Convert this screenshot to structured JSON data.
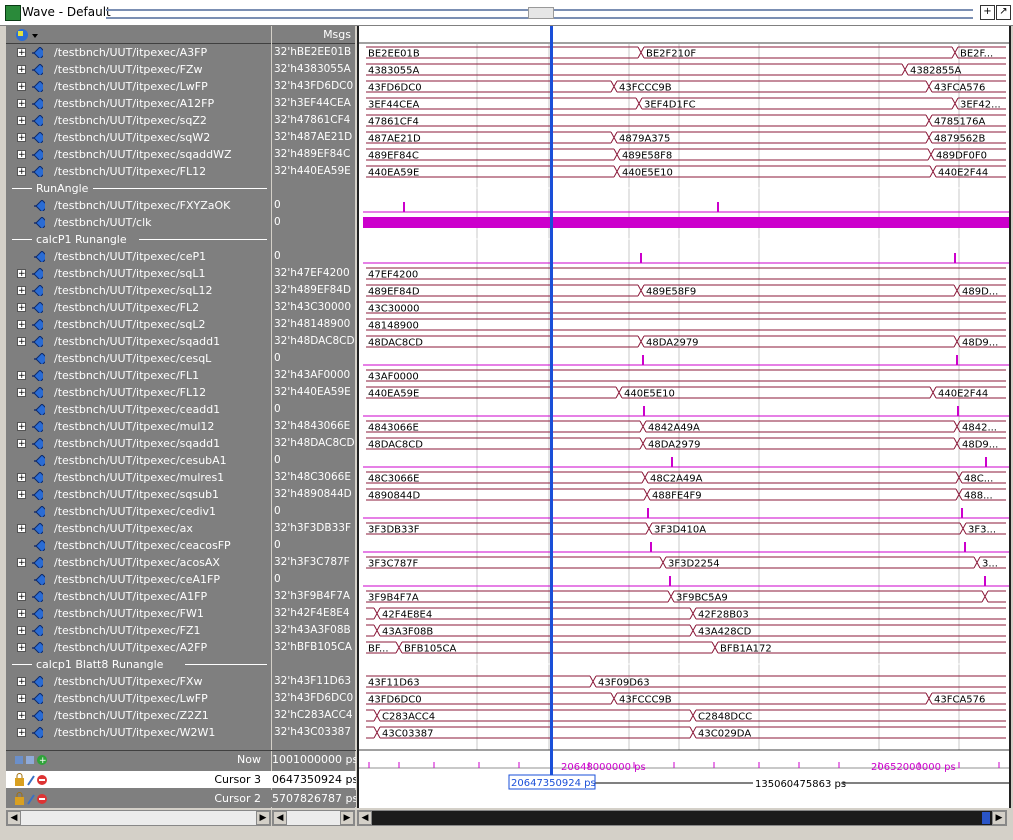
{
  "window": {
    "title": "Wave - Default"
  },
  "header": {
    "msgs_label": "Msgs"
  },
  "rows": [
    {
      "kind": "sig",
      "expand": true,
      "name": "/testbnch/UUT/itpexec/A3FP",
      "value": "32'hBE2EE01B"
    },
    {
      "kind": "sig",
      "expand": true,
      "name": "/testbnch/UUT/itpexec/FZw",
      "value": "32'h4383055A"
    },
    {
      "kind": "sig",
      "expand": true,
      "name": "/testbnch/UUT/itpexec/LwFP",
      "value": "32'h43FD6DC0"
    },
    {
      "kind": "sig",
      "expand": true,
      "name": "/testbnch/UUT/itpexec/A12FP",
      "value": "32'h3EF44CEA"
    },
    {
      "kind": "sig",
      "expand": true,
      "name": "/testbnch/UUT/itpexec/sqZ2",
      "value": "32'h47861CF4"
    },
    {
      "kind": "sig",
      "expand": true,
      "name": "/testbnch/UUT/itpexec/sqW2",
      "value": "32'h487AE21D"
    },
    {
      "kind": "sig",
      "expand": true,
      "name": "/testbnch/UUT/itpexec/sqaddWZ",
      "value": "32'h489EF84C"
    },
    {
      "kind": "sig",
      "expand": true,
      "name": "/testbnch/UUT/itpexec/FL12",
      "value": "32'h440EA59E"
    },
    {
      "kind": "sep",
      "name": "RunAngle",
      "value": ""
    },
    {
      "kind": "sig",
      "expand": false,
      "name": "/testbnch/UUT/itpexec/FXYZaOK",
      "value": "0"
    },
    {
      "kind": "sig",
      "expand": false,
      "name": "/testbnch/UUT/clk",
      "value": "0"
    },
    {
      "kind": "sep",
      "name": "calcP1 Runangle",
      "value": ""
    },
    {
      "kind": "sig",
      "expand": false,
      "name": "/testbnch/UUT/itpexec/ceP1",
      "value": "0"
    },
    {
      "kind": "sig",
      "expand": true,
      "name": "/testbnch/UUT/itpexec/sqL1",
      "value": "32'h47EF4200"
    },
    {
      "kind": "sig",
      "expand": true,
      "name": "/testbnch/UUT/itpexec/sqL12",
      "value": "32'h489EF84D"
    },
    {
      "kind": "sig",
      "expand": true,
      "name": "/testbnch/UUT/itpexec/FL2",
      "value": "32'h43C30000"
    },
    {
      "kind": "sig",
      "expand": true,
      "name": "/testbnch/UUT/itpexec/sqL2",
      "value": "32'h48148900"
    },
    {
      "kind": "sig",
      "expand": true,
      "name": "/testbnch/UUT/itpexec/sqadd1",
      "value": "32'h48DAC8CD"
    },
    {
      "kind": "sig",
      "expand": false,
      "name": "/testbnch/UUT/itpexec/cesqL",
      "value": "0"
    },
    {
      "kind": "sig",
      "expand": true,
      "name": "/testbnch/UUT/itpexec/FL1",
      "value": "32'h43AF0000"
    },
    {
      "kind": "sig",
      "expand": true,
      "name": "/testbnch/UUT/itpexec/FL12",
      "value": "32'h440EA59E"
    },
    {
      "kind": "sig",
      "expand": false,
      "name": "/testbnch/UUT/itpexec/ceadd1",
      "value": "0"
    },
    {
      "kind": "sig",
      "expand": true,
      "name": "/testbnch/UUT/itpexec/mul12",
      "value": "32'h4843066E"
    },
    {
      "kind": "sig",
      "expand": true,
      "name": "/testbnch/UUT/itpexec/sqadd1",
      "value": "32'h48DAC8CD"
    },
    {
      "kind": "sig",
      "expand": false,
      "name": "/testbnch/UUT/itpexec/cesubA1",
      "value": "0"
    },
    {
      "kind": "sig",
      "expand": true,
      "name": "/testbnch/UUT/itpexec/mulres1",
      "value": "32'h48C3066E"
    },
    {
      "kind": "sig",
      "expand": true,
      "name": "/testbnch/UUT/itpexec/sqsub1",
      "value": "32'h4890844D"
    },
    {
      "kind": "sig",
      "expand": false,
      "name": "/testbnch/UUT/itpexec/cediv1",
      "value": "0"
    },
    {
      "kind": "sig",
      "expand": true,
      "name": "/testbnch/UUT/itpexec/ax",
      "value": "32'h3F3DB33F"
    },
    {
      "kind": "sig",
      "expand": false,
      "name": "/testbnch/UUT/itpexec/ceacosFP",
      "value": "0"
    },
    {
      "kind": "sig",
      "expand": true,
      "name": "/testbnch/UUT/itpexec/acosAX",
      "value": "32'h3F3C787F"
    },
    {
      "kind": "sig",
      "expand": false,
      "name": "/testbnch/UUT/itpexec/ceA1FP",
      "value": "0"
    },
    {
      "kind": "sig",
      "expand": true,
      "name": "/testbnch/UUT/itpexec/A1FP",
      "value": "32'h3F9B4F7A"
    },
    {
      "kind": "sig",
      "expand": true,
      "name": "/testbnch/UUT/itpexec/FW1",
      "value": "32'h42F4E8E4"
    },
    {
      "kind": "sig",
      "expand": true,
      "name": "/testbnch/UUT/itpexec/FZ1",
      "value": "32'h43A3F08B"
    },
    {
      "kind": "sig",
      "expand": true,
      "name": "/testbnch/UUT/itpexec/A2FP",
      "value": "32'hBFB105CA"
    },
    {
      "kind": "sep",
      "name": "calcp1 Blatt8 Runangle",
      "value": ""
    },
    {
      "kind": "sig",
      "expand": true,
      "name": "/testbnch/UUT/itpexec/FXw",
      "value": "32'h43F11D63"
    },
    {
      "kind": "sig",
      "expand": true,
      "name": "/testbnch/UUT/itpexec/LwFP",
      "value": "32'h43FD6DC0"
    },
    {
      "kind": "sig",
      "expand": true,
      "name": "/testbnch/UUT/itpexec/Z2Z1",
      "value": "32'hC283ACC4"
    },
    {
      "kind": "sig",
      "expand": true,
      "name": "/testbnch/UUT/itpexec/W2W1",
      "value": "32'h43C03387"
    }
  ],
  "waves": [
    {
      "t": "bus",
      "segs": [
        [
          4,
          "BE2EE01B"
        ],
        [
          282,
          "BE2F210F"
        ],
        [
          596,
          "BE2F..."
        ]
      ]
    },
    {
      "t": "bus",
      "segs": [
        [
          4,
          "4383055A"
        ],
        [
          546,
          "4382855A"
        ]
      ]
    },
    {
      "t": "bus",
      "segs": [
        [
          4,
          "43FD6DC0"
        ],
        [
          255,
          "43FCCC9B"
        ],
        [
          570,
          "43FCA576"
        ]
      ]
    },
    {
      "t": "bus",
      "segs": [
        [
          4,
          "3EF44CEA"
        ],
        [
          280,
          "3EF4D1FC"
        ],
        [
          596,
          "3EF42..."
        ]
      ]
    },
    {
      "t": "bus",
      "segs": [
        [
          4,
          "47861CF4"
        ],
        [
          570,
          "4785176A"
        ]
      ]
    },
    {
      "t": "bus",
      "segs": [
        [
          4,
          "487AE21D"
        ],
        [
          255,
          "4879A375"
        ],
        [
          570,
          "4879562B"
        ]
      ]
    },
    {
      "t": "bus",
      "segs": [
        [
          4,
          "489EF84C"
        ],
        [
          258,
          "489E58F8"
        ],
        [
          572,
          "489DF0F0"
        ]
      ]
    },
    {
      "t": "bus",
      "segs": [
        [
          4,
          "440EA59E"
        ],
        [
          258,
          "440E5E10"
        ],
        [
          574,
          "440E2F44"
        ]
      ]
    },
    {
      "t": "sep"
    },
    {
      "t": "pulse",
      "x": [
        44,
        358
      ]
    },
    {
      "t": "clk"
    },
    {
      "t": "sep"
    },
    {
      "t": "pulse",
      "x": [
        281,
        595
      ]
    },
    {
      "t": "bus",
      "segs": [
        [
          4,
          "47EF4200"
        ]
      ]
    },
    {
      "t": "bus",
      "segs": [
        [
          4,
          "489EF84D"
        ],
        [
          282,
          "489E58F9"
        ],
        [
          598,
          "489D..."
        ]
      ]
    },
    {
      "t": "bus",
      "segs": [
        [
          4,
          "43C30000"
        ]
      ]
    },
    {
      "t": "bus",
      "segs": [
        [
          4,
          "48148900"
        ]
      ]
    },
    {
      "t": "bus",
      "segs": [
        [
          4,
          "48DAC8CD"
        ],
        [
          282,
          "48DA2979"
        ],
        [
          598,
          "48D9..."
        ]
      ]
    },
    {
      "t": "pulse",
      "x": [
        283,
        597
      ]
    },
    {
      "t": "bus",
      "segs": [
        [
          4,
          "43AF0000"
        ]
      ]
    },
    {
      "t": "bus",
      "segs": [
        [
          4,
          "440EA59E"
        ],
        [
          260,
          "440E5E10"
        ],
        [
          574,
          "440E2F44"
        ]
      ]
    },
    {
      "t": "pulse",
      "x": [
        284,
        598
      ]
    },
    {
      "t": "bus",
      "segs": [
        [
          4,
          "4843066E"
        ],
        [
          284,
          "4842A49A"
        ],
        [
          598,
          "4842..."
        ]
      ]
    },
    {
      "t": "bus",
      "segs": [
        [
          4,
          "48DAC8CD"
        ],
        [
          284,
          "48DA2979"
        ],
        [
          598,
          "48D9..."
        ]
      ]
    },
    {
      "t": "pulse",
      "x": [
        312,
        626
      ]
    },
    {
      "t": "bus",
      "segs": [
        [
          4,
          "48C3066E"
        ],
        [
          286,
          "48C2A49A"
        ],
        [
          600,
          "48C..."
        ]
      ]
    },
    {
      "t": "bus",
      "segs": [
        [
          4,
          "4890844D"
        ],
        [
          288,
          "488FE4F9"
        ],
        [
          600,
          "488..."
        ]
      ]
    },
    {
      "t": "pulse",
      "x": [
        288,
        602
      ]
    },
    {
      "t": "bus",
      "segs": [
        [
          4,
          "3F3DB33F"
        ],
        [
          290,
          "3F3D410A"
        ],
        [
          604,
          "3F3..."
        ]
      ]
    },
    {
      "t": "pulse",
      "x": [
        291,
        605
      ]
    },
    {
      "t": "bus",
      "segs": [
        [
          4,
          "3F3C787F"
        ],
        [
          304,
          "3F3D2254"
        ],
        [
          618,
          "3..."
        ]
      ]
    },
    {
      "t": "pulse",
      "x": [
        310,
        625
      ]
    },
    {
      "t": "bus",
      "segs": [
        [
          4,
          "3F9B4F7A"
        ],
        [
          312,
          "3F9BC5A9"
        ],
        [
          626,
          ""
        ]
      ]
    },
    {
      "t": "bus",
      "segs": [
        [
          4,
          ""
        ],
        [
          18,
          "42F4E8E4"
        ],
        [
          334,
          "42F28B03"
        ]
      ]
    },
    {
      "t": "bus",
      "segs": [
        [
          4,
          ""
        ],
        [
          18,
          "43A3F08B"
        ],
        [
          334,
          "43A428CD"
        ]
      ]
    },
    {
      "t": "bus",
      "segs": [
        [
          4,
          "BF..."
        ],
        [
          40,
          "BFB105CA"
        ],
        [
          356,
          "BFB1A172"
        ]
      ]
    },
    {
      "t": "sep"
    },
    {
      "t": "bus",
      "segs": [
        [
          4,
          "43F11D63"
        ],
        [
          234,
          "43F09D63"
        ]
      ]
    },
    {
      "t": "bus",
      "segs": [
        [
          4,
          "43FD6DC0"
        ],
        [
          255,
          "43FCCC9B"
        ],
        [
          570,
          "43FCA576"
        ]
      ]
    },
    {
      "t": "bus",
      "segs": [
        [
          4,
          ""
        ],
        [
          18,
          "C283ACC4"
        ],
        [
          334,
          "C2848DCC"
        ]
      ]
    },
    {
      "t": "bus",
      "segs": [
        [
          4,
          ""
        ],
        [
          18,
          "43C03387"
        ],
        [
          334,
          "43C029DA"
        ]
      ]
    }
  ],
  "bottom": {
    "now_label": "Now",
    "now_value": "1001000000 ps",
    "cursor3_label": "Cursor 3",
    "cursor3_value": "0647350924 ps",
    "cursor2_label": "Cursor 2",
    "cursor2_value": "5707826787 ps"
  },
  "timeline": {
    "tick1": "20648000000 ps",
    "tick2": "20652000000 ps",
    "cursor_label": "20647350924 ps",
    "delta_label": "135060475863 ps"
  },
  "colors": {
    "bus": "#8b1a3a",
    "pulse": "#cc00cc",
    "cursor": "#1a4fd8",
    "grid": "#909090"
  }
}
